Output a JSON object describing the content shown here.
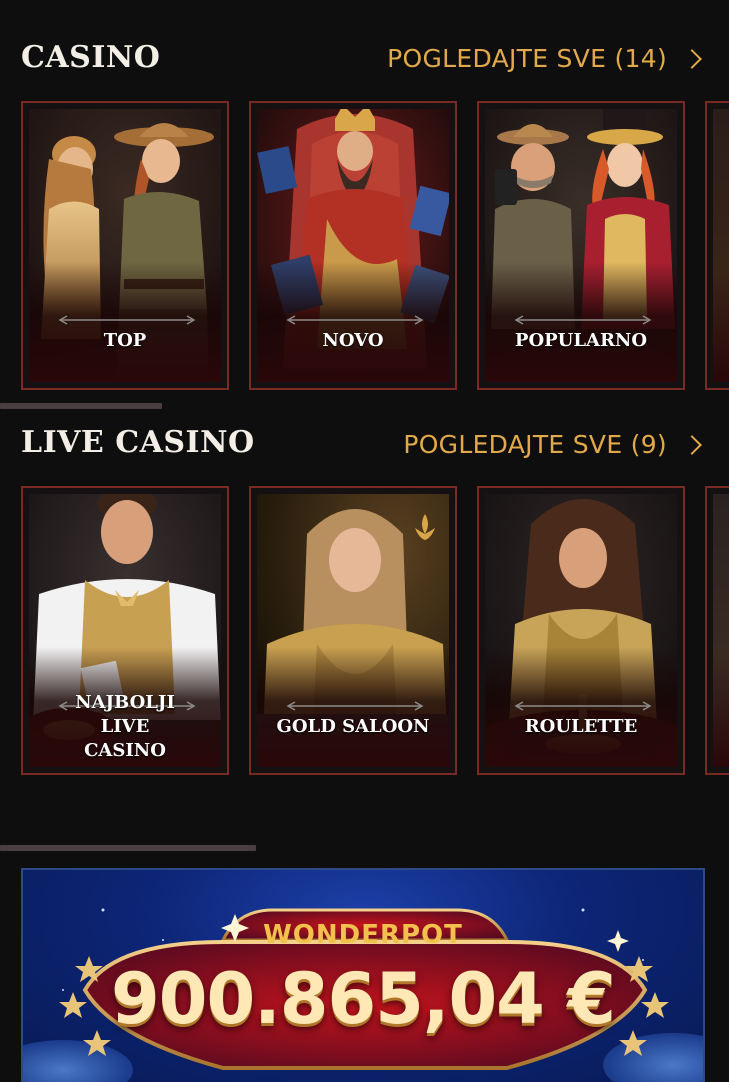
{
  "casino": {
    "title": "CASINO",
    "see_all": "POGLEDAJTE SVE (14)",
    "cards": [
      {
        "label": "TOP",
        "icon": "explorer-heroes-art"
      },
      {
        "label": "NOVO",
        "icon": "king-on-throne-art"
      },
      {
        "label": "POPULARNO",
        "icon": "ringmaster-art"
      }
    ]
  },
  "live_casino": {
    "title": "LIVE CASINO",
    "see_all": "POGLEDAJTE SVE (9)",
    "cards": [
      {
        "label": "NAJBOLJI LIVE CASINO",
        "icon": "male-dealer-art"
      },
      {
        "label": "GOLD SALOON",
        "icon": "female-dealer-gold-art"
      },
      {
        "label": "ROULETTE",
        "icon": "roulette-dealer-art"
      }
    ]
  },
  "jackpot": {
    "title": "WONDERPOT",
    "amount": "900.865,04 €"
  },
  "colors": {
    "accent": "#e2a94a",
    "card_border": "#7a2a24",
    "background": "#0e0e0f",
    "jackpot_blue": "#0d2576"
  }
}
